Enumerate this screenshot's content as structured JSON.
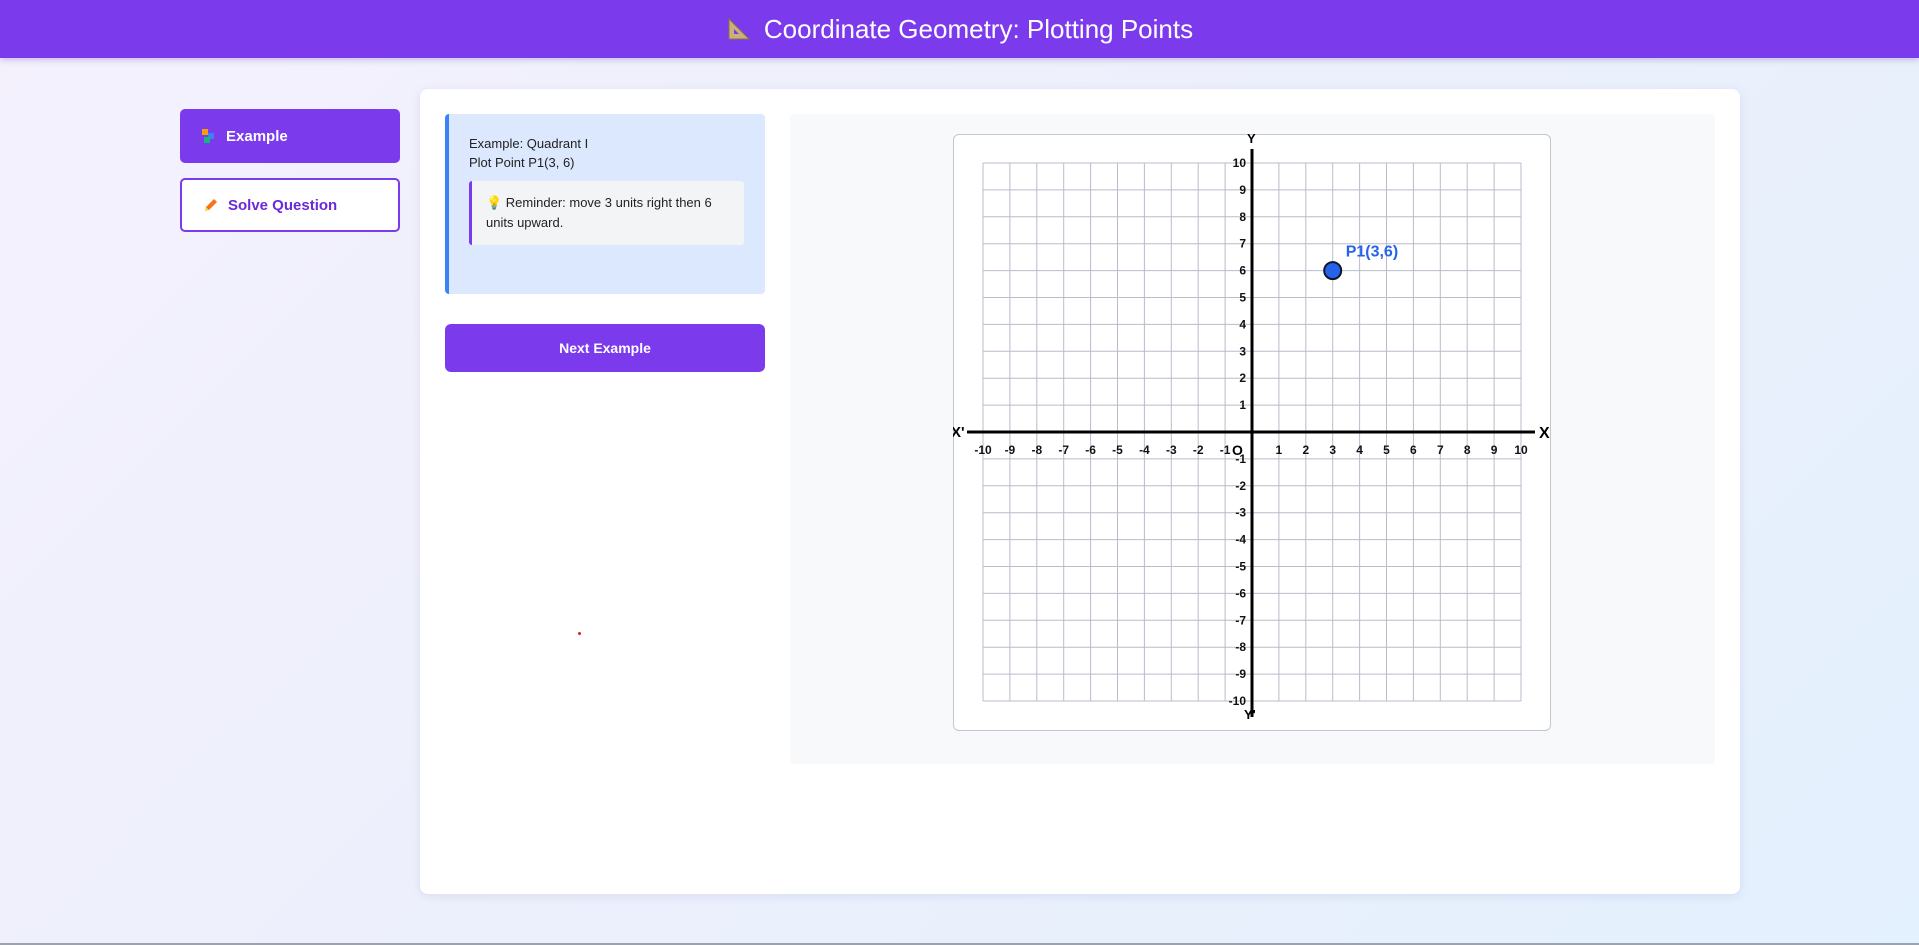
{
  "header": {
    "title": "Coordinate Geometry: Plotting Points",
    "icon": "triangle-ruler-icon"
  },
  "sidebar": {
    "items": [
      {
        "label": "Example",
        "icon": "blocks-icon",
        "active": true
      },
      {
        "label": "Solve Question",
        "icon": "pencil-icon",
        "active": false
      }
    ]
  },
  "example": {
    "title": "Example: Quadrant I",
    "instruction": "Plot Point P1(3, 6)",
    "reminder": "💡 Reminder: move 3 units right then 6 units upward.",
    "next_button": "Next Example"
  },
  "chart_data": {
    "type": "scatter",
    "xlim": [
      -10,
      10
    ],
    "ylim": [
      -10,
      10
    ],
    "grid": true,
    "x_axis_labels": {
      "positive": "X",
      "negative": "X'"
    },
    "y_axis_labels": {
      "positive": "Y",
      "negative": "Y'"
    },
    "origin_label": "O",
    "x_ticks": [
      -10,
      -9,
      -8,
      -7,
      -6,
      -5,
      -4,
      -3,
      -2,
      -1,
      1,
      2,
      3,
      4,
      5,
      6,
      7,
      8,
      9,
      10
    ],
    "y_ticks": [
      -10,
      -9,
      -8,
      -7,
      -6,
      -5,
      -4,
      -3,
      -2,
      -1,
      1,
      2,
      3,
      4,
      5,
      6,
      7,
      8,
      9,
      10
    ],
    "points": [
      {
        "label": "P1(3,6)",
        "x": 3,
        "y": 6
      }
    ]
  },
  "colors": {
    "accent": "#7c3aed",
    "point_fill": "#2563eb",
    "point_label": "#2563eb",
    "grid": "#b8bccb"
  }
}
